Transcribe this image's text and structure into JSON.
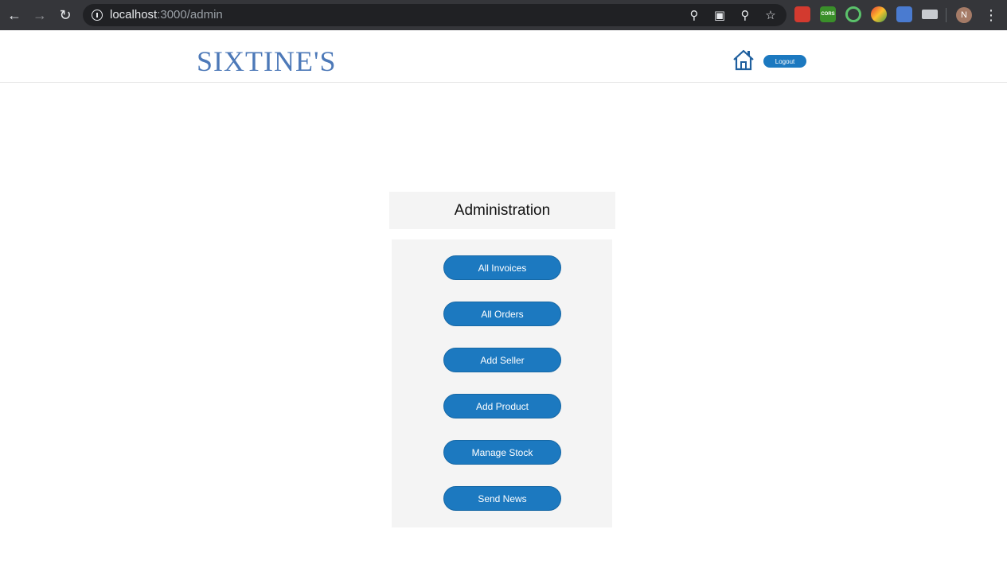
{
  "browser": {
    "url_host": "localhost",
    "url_path": ":3000/admin",
    "profile_initial": "N",
    "extensions": [
      "extension-red-icon",
      "cors-icon",
      "target-icon",
      "color-picker-icon",
      "translate-icon",
      "mail-icon"
    ],
    "extension_cors_label": "CORS"
  },
  "header": {
    "logo": "SIXTINE'S",
    "logout_label": "Logout"
  },
  "admin": {
    "title": "Administration",
    "buttons": [
      {
        "label": "All Invoices"
      },
      {
        "label": "All Orders"
      },
      {
        "label": "Add Seller"
      },
      {
        "label": "Add Product"
      },
      {
        "label": "Manage Stock"
      },
      {
        "label": "Send News"
      }
    ]
  },
  "colors": {
    "accent": "#1c79c0",
    "logo": "#4d79b8",
    "panel_bg": "#f4f4f4"
  }
}
